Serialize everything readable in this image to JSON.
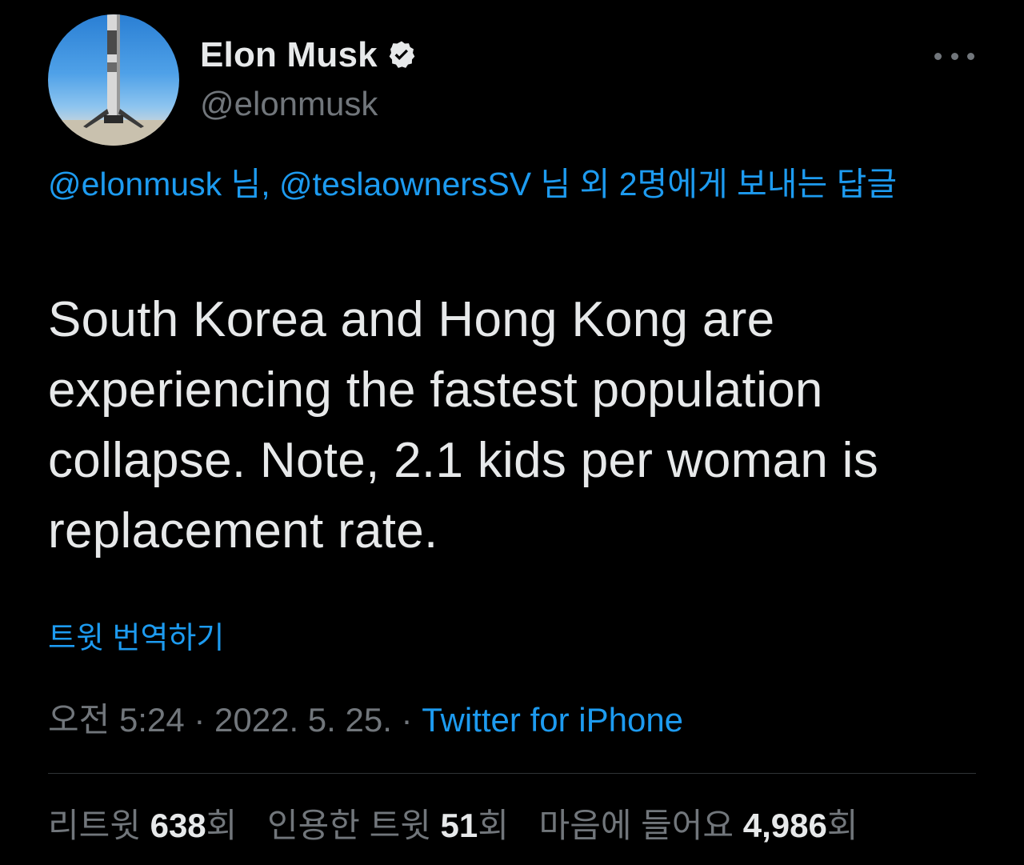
{
  "author": {
    "display_name": "Elon Musk",
    "handle": "@elonmusk",
    "verified": true
  },
  "reply_context": {
    "mention_1": "@elonmusk",
    "suffix_1": " 님, ",
    "mention_2": "@teslaownersSV",
    "suffix_2": " 님 외 2명에게 보내는 답글"
  },
  "tweet": {
    "text": "South Korea and Hong Kong are experiencing the fastest population collapse. Note, 2.1 kids per woman is replacement rate."
  },
  "translate_label": "트윗 번역하기",
  "meta": {
    "time": "오전 5:24",
    "separator_1": " · ",
    "date": "2022. 5. 25.",
    "separator_2": " · ",
    "source": "Twitter for iPhone"
  },
  "stats": {
    "retweets": {
      "label": "리트윗 ",
      "count": "638",
      "unit": "회"
    },
    "quotes": {
      "label": "인용한 트윗 ",
      "count": "51",
      "unit": "회"
    },
    "likes": {
      "label": "마음에 들어요 ",
      "count": "4,986",
      "unit": "회"
    }
  },
  "colors": {
    "background": "#000000",
    "text_primary": "#e7e9ea",
    "text_secondary": "#71767b",
    "link": "#1d9bf0",
    "divider": "#2f3336"
  },
  "icons": {
    "verified": "verified-badge-icon",
    "more": "more-options-icon"
  }
}
